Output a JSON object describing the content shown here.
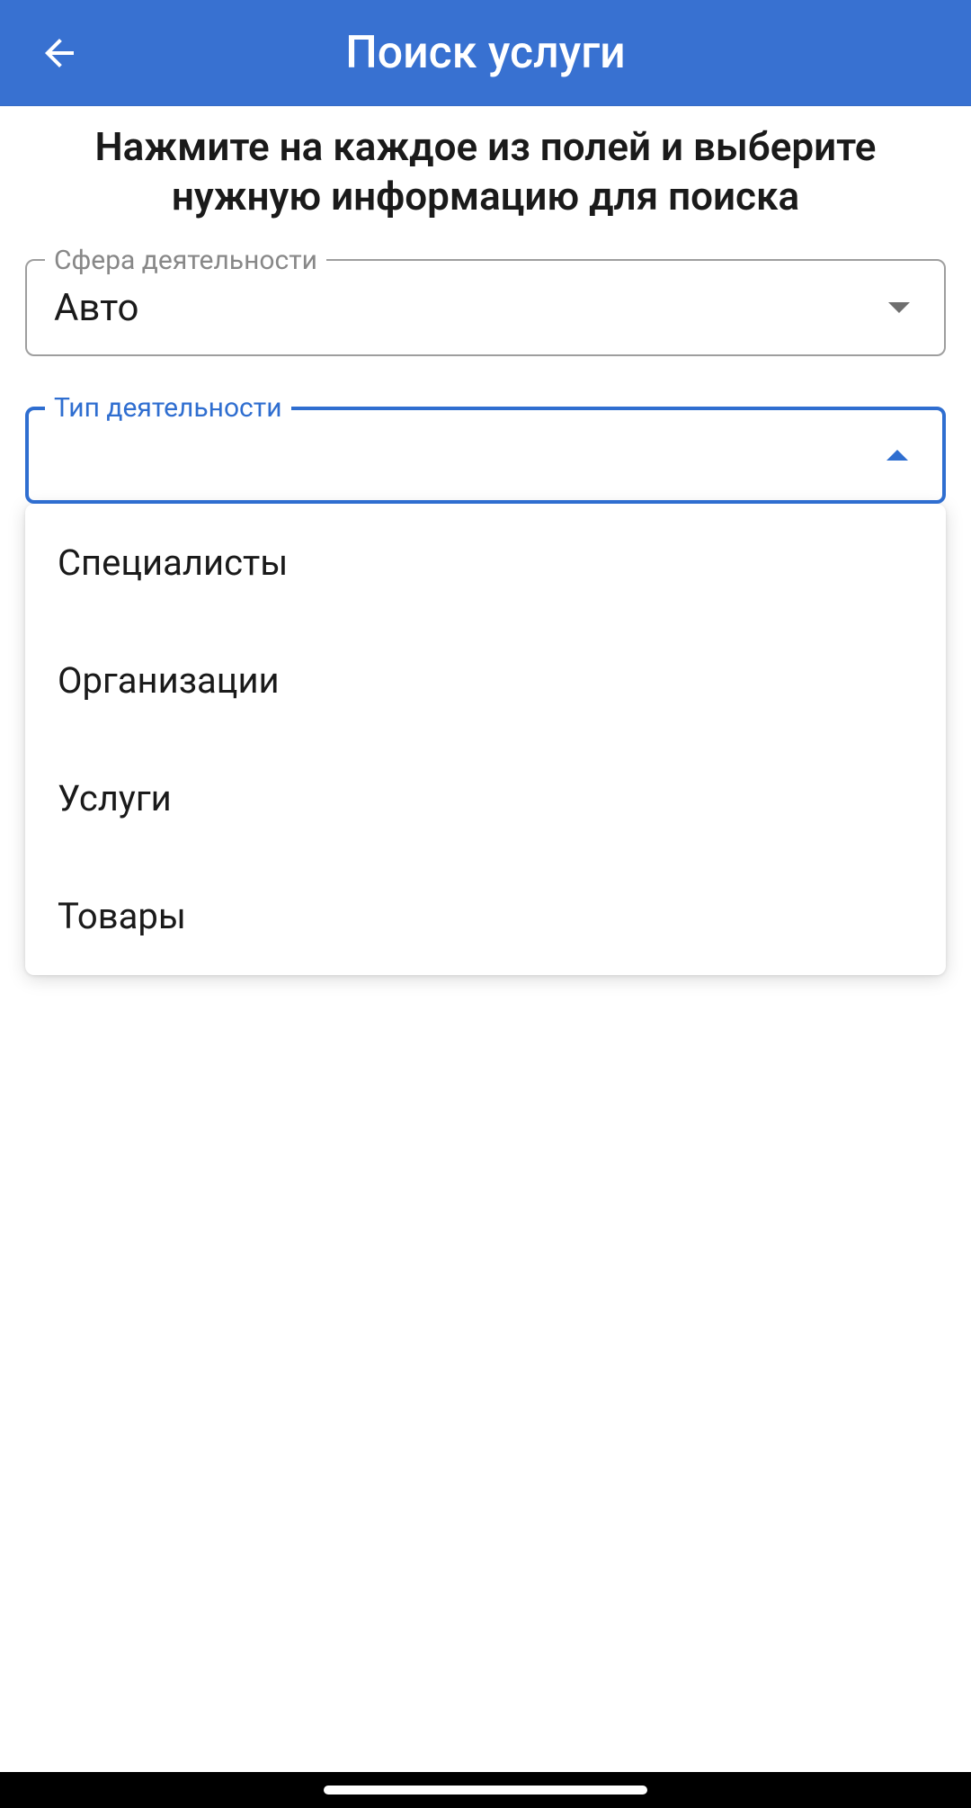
{
  "header": {
    "title": "Поиск услуги"
  },
  "instruction": "Нажмите на каждое из полей и выберите нужную информацию для поиска",
  "field1": {
    "label": "Сфера деятельности",
    "value": "Авто"
  },
  "field2": {
    "label": "Тип деятельности",
    "value": ""
  },
  "dropdown": {
    "options": [
      "Специалисты",
      "Организации",
      "Услуги",
      "Товары"
    ]
  }
}
